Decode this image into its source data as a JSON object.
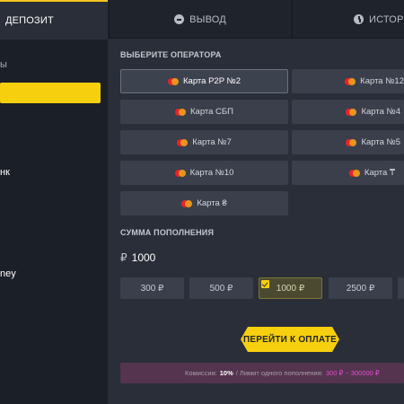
{
  "tabs": [
    {
      "label": "ДЕПОЗИТ"
    },
    {
      "label": "ВЫВОД",
      "icon": "minus-circle-icon"
    },
    {
      "label": "ИСТОРИ",
      "icon": "clock-icon"
    }
  ],
  "sidebar": {
    "items": [
      {
        "label": "ы"
      },
      {
        "label": "нк"
      },
      {
        "label": "ney"
      }
    ]
  },
  "operators": {
    "title": "ВЫБЕРИТЕ ОПЕРАТОРА",
    "items": [
      {
        "label": "Карта P2P №2",
        "selected": true
      },
      {
        "label": "Карта №12"
      },
      {
        "label": "Карта СБП"
      },
      {
        "label": "Карта №4"
      },
      {
        "label": "Карта №7"
      },
      {
        "label": "Карта №5"
      },
      {
        "label": "Карта №10"
      },
      {
        "label": "Карта ₸"
      },
      {
        "label": "Карта ₴"
      }
    ]
  },
  "amount": {
    "title": "СУММА ПОПОЛНЕНИЯ",
    "currency": "₽",
    "value": "1000",
    "presets": [
      "300 ₽",
      "500 ₽",
      "1000 ₽",
      "2500 ₽"
    ],
    "selected_preset": "1000 ₽"
  },
  "pay_button": {
    "label": "ПЕРЕЙТИ К ОПЛАТЕ"
  },
  "info": {
    "commission_label": "Комиссия:",
    "commission_value": "10%",
    "limit_label": "/ Лимит одного пополнения:",
    "limit_value": "300 ₽ ~ 300000 ₽"
  },
  "colors": {
    "accent": "#f6cf0e",
    "background": "#2a2e38",
    "sidebar": "#1b1f27",
    "info_bar": "#54344f",
    "limit_text": "#e04fd0"
  }
}
